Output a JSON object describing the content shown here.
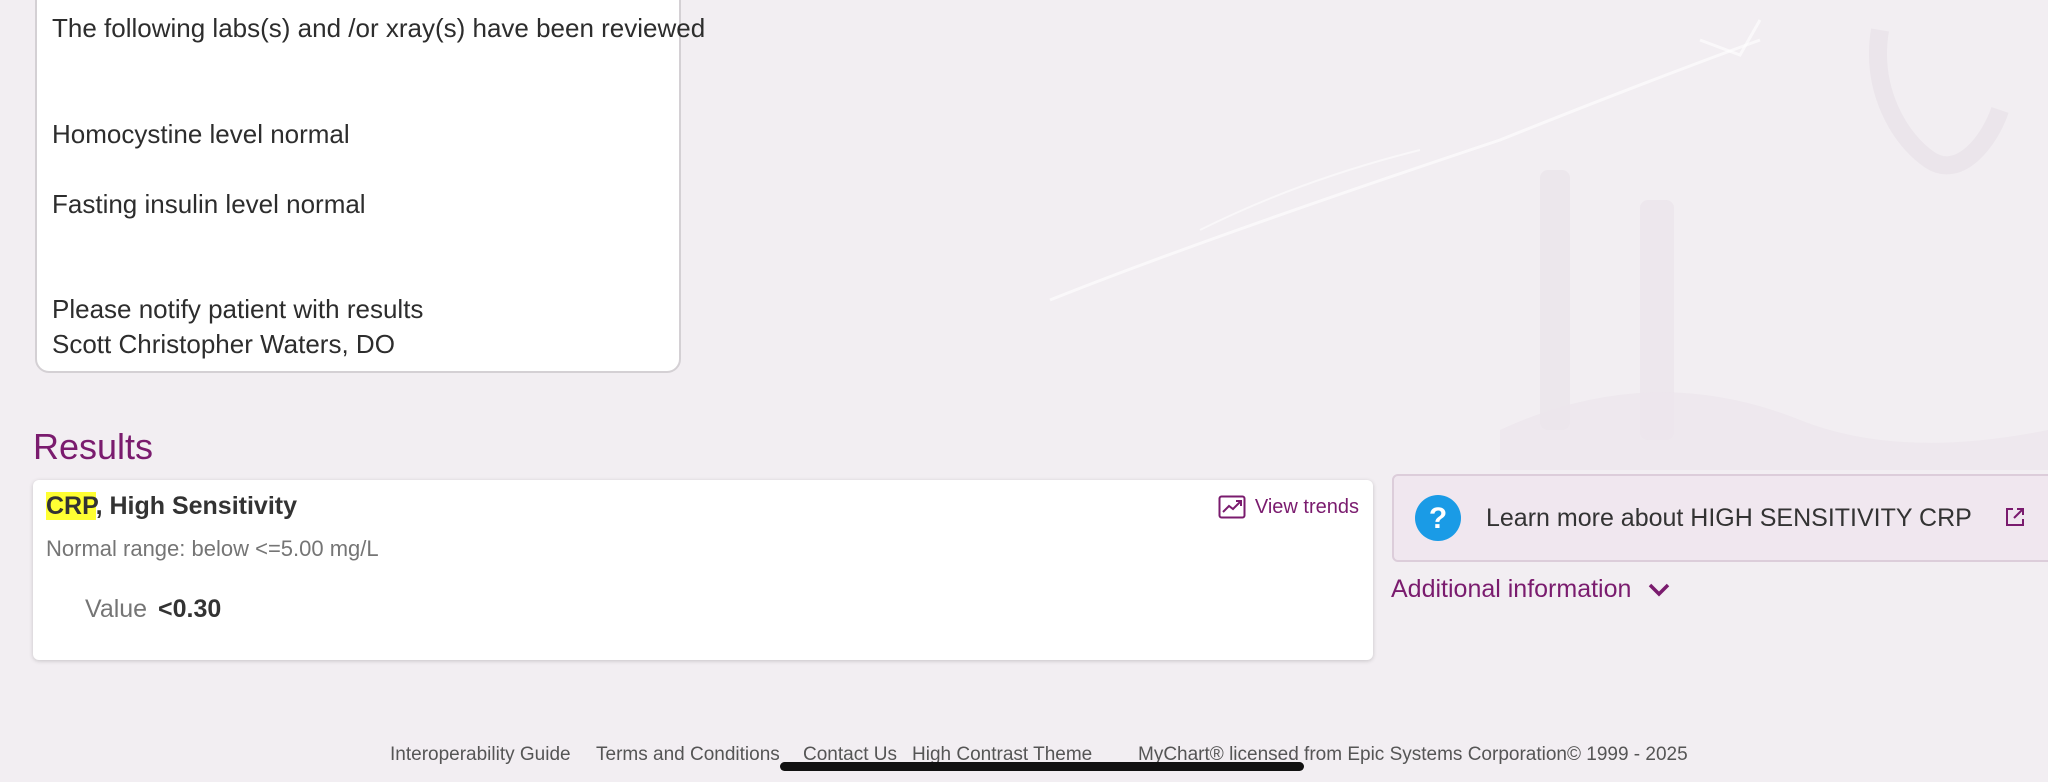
{
  "comment": {
    "lines": [
      "The following labs(s) and /or xray(s) have been reviewed",
      "Homocystine level normal",
      "Fasting insulin level normal",
      "Please notify patient with results",
      "Scott Christopher Waters, DO"
    ]
  },
  "results": {
    "heading": "Results",
    "card": {
      "title_highlight": "CRP",
      "title_rest": ", High Sensitivity",
      "view_trends_label": "View trends",
      "normal_range": "Normal range: below <=5.00 mg/L",
      "value_label": "Value",
      "value": "<0.30"
    },
    "learn_more": {
      "label": "Learn more about HIGH SENSITIVITY CRP",
      "icon": "question-icon"
    },
    "additional_info_label": "Additional information"
  },
  "footer": {
    "links": [
      "Interoperability Guide",
      "Terms and Conditions",
      "Contact Us",
      "High Contrast Theme"
    ],
    "copyright": "MyChart® licensed from Epic Systems Corporation© 1999 - 2025"
  },
  "colors": {
    "accent": "#7a1b6e",
    "highlight": "#ffff33",
    "info_icon": "#1a9be6",
    "background": "#f2eef2"
  }
}
